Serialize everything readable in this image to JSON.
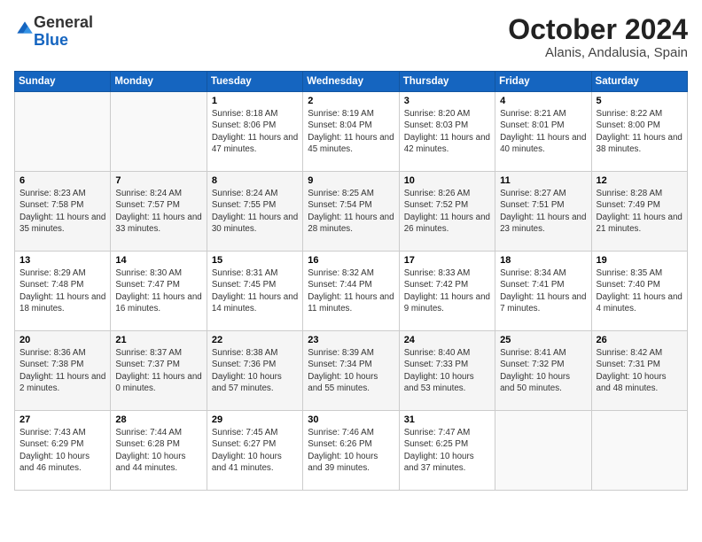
{
  "logo": {
    "general": "General",
    "blue": "Blue"
  },
  "header": {
    "month": "October 2024",
    "location": "Alanis, Andalusia, Spain"
  },
  "weekdays": [
    "Sunday",
    "Monday",
    "Tuesday",
    "Wednesday",
    "Thursday",
    "Friday",
    "Saturday"
  ],
  "weeks": [
    [
      {
        "day": null,
        "sunrise": null,
        "sunset": null,
        "daylight": null
      },
      {
        "day": null,
        "sunrise": null,
        "sunset": null,
        "daylight": null
      },
      {
        "day": "1",
        "sunrise": "Sunrise: 8:18 AM",
        "sunset": "Sunset: 8:06 PM",
        "daylight": "Daylight: 11 hours and 47 minutes."
      },
      {
        "day": "2",
        "sunrise": "Sunrise: 8:19 AM",
        "sunset": "Sunset: 8:04 PM",
        "daylight": "Daylight: 11 hours and 45 minutes."
      },
      {
        "day": "3",
        "sunrise": "Sunrise: 8:20 AM",
        "sunset": "Sunset: 8:03 PM",
        "daylight": "Daylight: 11 hours and 42 minutes."
      },
      {
        "day": "4",
        "sunrise": "Sunrise: 8:21 AM",
        "sunset": "Sunset: 8:01 PM",
        "daylight": "Daylight: 11 hours and 40 minutes."
      },
      {
        "day": "5",
        "sunrise": "Sunrise: 8:22 AM",
        "sunset": "Sunset: 8:00 PM",
        "daylight": "Daylight: 11 hours and 38 minutes."
      }
    ],
    [
      {
        "day": "6",
        "sunrise": "Sunrise: 8:23 AM",
        "sunset": "Sunset: 7:58 PM",
        "daylight": "Daylight: 11 hours and 35 minutes."
      },
      {
        "day": "7",
        "sunrise": "Sunrise: 8:24 AM",
        "sunset": "Sunset: 7:57 PM",
        "daylight": "Daylight: 11 hours and 33 minutes."
      },
      {
        "day": "8",
        "sunrise": "Sunrise: 8:24 AM",
        "sunset": "Sunset: 7:55 PM",
        "daylight": "Daylight: 11 hours and 30 minutes."
      },
      {
        "day": "9",
        "sunrise": "Sunrise: 8:25 AM",
        "sunset": "Sunset: 7:54 PM",
        "daylight": "Daylight: 11 hours and 28 minutes."
      },
      {
        "day": "10",
        "sunrise": "Sunrise: 8:26 AM",
        "sunset": "Sunset: 7:52 PM",
        "daylight": "Daylight: 11 hours and 26 minutes."
      },
      {
        "day": "11",
        "sunrise": "Sunrise: 8:27 AM",
        "sunset": "Sunset: 7:51 PM",
        "daylight": "Daylight: 11 hours and 23 minutes."
      },
      {
        "day": "12",
        "sunrise": "Sunrise: 8:28 AM",
        "sunset": "Sunset: 7:49 PM",
        "daylight": "Daylight: 11 hours and 21 minutes."
      }
    ],
    [
      {
        "day": "13",
        "sunrise": "Sunrise: 8:29 AM",
        "sunset": "Sunset: 7:48 PM",
        "daylight": "Daylight: 11 hours and 18 minutes."
      },
      {
        "day": "14",
        "sunrise": "Sunrise: 8:30 AM",
        "sunset": "Sunset: 7:47 PM",
        "daylight": "Daylight: 11 hours and 16 minutes."
      },
      {
        "day": "15",
        "sunrise": "Sunrise: 8:31 AM",
        "sunset": "Sunset: 7:45 PM",
        "daylight": "Daylight: 11 hours and 14 minutes."
      },
      {
        "day": "16",
        "sunrise": "Sunrise: 8:32 AM",
        "sunset": "Sunset: 7:44 PM",
        "daylight": "Daylight: 11 hours and 11 minutes."
      },
      {
        "day": "17",
        "sunrise": "Sunrise: 8:33 AM",
        "sunset": "Sunset: 7:42 PM",
        "daylight": "Daylight: 11 hours and 9 minutes."
      },
      {
        "day": "18",
        "sunrise": "Sunrise: 8:34 AM",
        "sunset": "Sunset: 7:41 PM",
        "daylight": "Daylight: 11 hours and 7 minutes."
      },
      {
        "day": "19",
        "sunrise": "Sunrise: 8:35 AM",
        "sunset": "Sunset: 7:40 PM",
        "daylight": "Daylight: 11 hours and 4 minutes."
      }
    ],
    [
      {
        "day": "20",
        "sunrise": "Sunrise: 8:36 AM",
        "sunset": "Sunset: 7:38 PM",
        "daylight": "Daylight: 11 hours and 2 minutes."
      },
      {
        "day": "21",
        "sunrise": "Sunrise: 8:37 AM",
        "sunset": "Sunset: 7:37 PM",
        "daylight": "Daylight: 11 hours and 0 minutes."
      },
      {
        "day": "22",
        "sunrise": "Sunrise: 8:38 AM",
        "sunset": "Sunset: 7:36 PM",
        "daylight": "Daylight: 10 hours and 57 minutes."
      },
      {
        "day": "23",
        "sunrise": "Sunrise: 8:39 AM",
        "sunset": "Sunset: 7:34 PM",
        "daylight": "Daylight: 10 hours and 55 minutes."
      },
      {
        "day": "24",
        "sunrise": "Sunrise: 8:40 AM",
        "sunset": "Sunset: 7:33 PM",
        "daylight": "Daylight: 10 hours and 53 minutes."
      },
      {
        "day": "25",
        "sunrise": "Sunrise: 8:41 AM",
        "sunset": "Sunset: 7:32 PM",
        "daylight": "Daylight: 10 hours and 50 minutes."
      },
      {
        "day": "26",
        "sunrise": "Sunrise: 8:42 AM",
        "sunset": "Sunset: 7:31 PM",
        "daylight": "Daylight: 10 hours and 48 minutes."
      }
    ],
    [
      {
        "day": "27",
        "sunrise": "Sunrise: 7:43 AM",
        "sunset": "Sunset: 6:29 PM",
        "daylight": "Daylight: 10 hours and 46 minutes."
      },
      {
        "day": "28",
        "sunrise": "Sunrise: 7:44 AM",
        "sunset": "Sunset: 6:28 PM",
        "daylight": "Daylight: 10 hours and 44 minutes."
      },
      {
        "day": "29",
        "sunrise": "Sunrise: 7:45 AM",
        "sunset": "Sunset: 6:27 PM",
        "daylight": "Daylight: 10 hours and 41 minutes."
      },
      {
        "day": "30",
        "sunrise": "Sunrise: 7:46 AM",
        "sunset": "Sunset: 6:26 PM",
        "daylight": "Daylight: 10 hours and 39 minutes."
      },
      {
        "day": "31",
        "sunrise": "Sunrise: 7:47 AM",
        "sunset": "Sunset: 6:25 PM",
        "daylight": "Daylight: 10 hours and 37 minutes."
      },
      {
        "day": null,
        "sunrise": null,
        "sunset": null,
        "daylight": null
      },
      {
        "day": null,
        "sunrise": null,
        "sunset": null,
        "daylight": null
      }
    ]
  ]
}
